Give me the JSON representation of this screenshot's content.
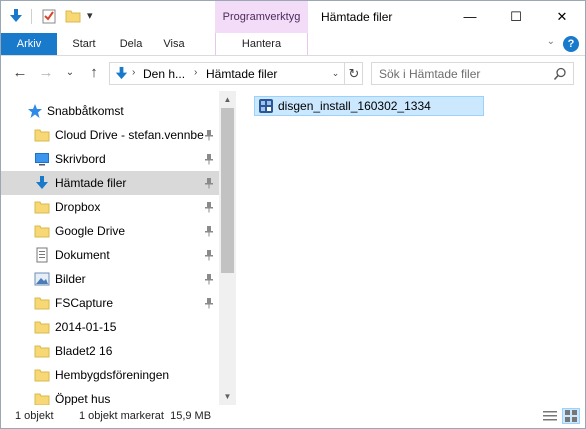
{
  "window": {
    "title": "Hämtade filer",
    "context_group": "Programverktyg",
    "controls": {
      "minimize": "—",
      "maximize": "☐",
      "close": "✕"
    }
  },
  "quick_access_toolbar": {
    "icons": [
      "download-folder-icon",
      "properties-icon",
      "new-folder-icon",
      "customize-dropdown-icon"
    ],
    "dropdown_glyph": "▾"
  },
  "ribbon": {
    "tabs": [
      {
        "label": "Arkiv"
      },
      {
        "label": "Start"
      },
      {
        "label": "Dela"
      },
      {
        "label": "Visa"
      }
    ],
    "context_tab": "Hantera",
    "collapse_glyph": "⌄",
    "help_glyph": "?"
  },
  "address": {
    "back_glyph": "←",
    "forward_glyph": "→",
    "recent_glyph": "⌄",
    "up_glyph": "↑",
    "breadcrumbs": [
      "Den h...",
      "Hämtade filer"
    ],
    "separator": "›",
    "dropdown_glyph": "⌄",
    "refresh_glyph": "↻"
  },
  "search": {
    "placeholder": "Sök i Hämtade filer"
  },
  "nav_pane": {
    "quick_access_label": "Snabbåtkomst",
    "items": [
      {
        "label": "Cloud Drive - stefan.vennbe",
        "icon": "folder-icon",
        "pinned": true
      },
      {
        "label": "Skrivbord",
        "icon": "desktop-icon",
        "pinned": true
      },
      {
        "label": "Hämtade filer",
        "icon": "download-icon",
        "pinned": true,
        "selected": true
      },
      {
        "label": "Dropbox",
        "icon": "folder-icon",
        "pinned": true
      },
      {
        "label": "Google Drive",
        "icon": "folder-icon",
        "pinned": true
      },
      {
        "label": "Dokument",
        "icon": "document-icon",
        "pinned": true
      },
      {
        "label": "Bilder",
        "icon": "pictures-icon",
        "pinned": true
      },
      {
        "label": "FSCapture",
        "icon": "folder-icon",
        "pinned": true
      },
      {
        "label": "2014-01-15",
        "icon": "folder-icon",
        "pinned": false
      },
      {
        "label": "Bladet2 16",
        "icon": "folder-icon",
        "pinned": false
      },
      {
        "label": "Hembygdsföreningen",
        "icon": "folder-icon",
        "pinned": false
      },
      {
        "label": "Öppet hus",
        "icon": "folder-icon",
        "pinned": false
      }
    ],
    "scroll_up_glyph": "▲",
    "scroll_down_glyph": "▼"
  },
  "files": [
    {
      "name": "disgen_install_160302_1334",
      "icon": "installer-icon",
      "selected": true
    }
  ],
  "status": {
    "count": "1 objekt",
    "selection": "1 objekt markerat  15,9 MB"
  },
  "colors": {
    "accent": "#1979ca",
    "context_tab": "#f2dcf7",
    "selection_fill": "#cce8ff",
    "selection_border": "#99d1ff",
    "nav_selected": "#d9d9d9",
    "folder": "#f8d775"
  }
}
